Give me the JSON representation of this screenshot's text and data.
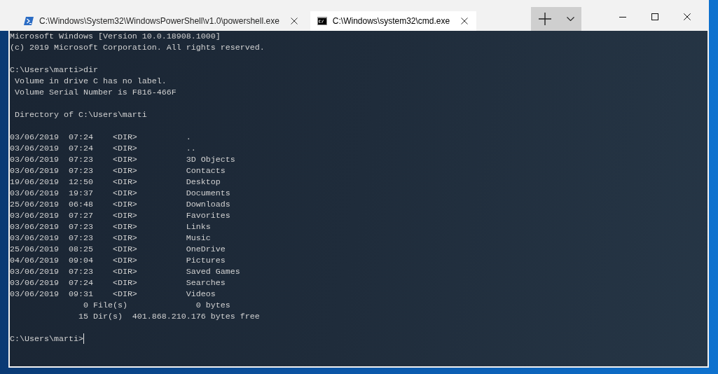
{
  "window": {
    "tabs": [
      {
        "kind": "powershell",
        "title": "C:\\Windows\\System32\\WindowsPowerShell\\v1.0\\powershell.exe",
        "selected": false
      },
      {
        "kind": "cmd",
        "title": "C:\\Windows\\system32\\cmd.exe",
        "selected": true
      }
    ]
  },
  "terminal": {
    "output_blocks": [
      [
        "Microsoft Windows [Version 10.0.18908.1000]",
        "(c) 2019 Microsoft Corporation. All rights reserved."
      ],
      [
        "C:\\Users\\marti>dir",
        " Volume in drive C has no label.",
        " Volume Serial Number is F816-466F"
      ],
      [
        " Directory of C:\\Users\\marti"
      ],
      [
        "03/06/2019  07:24    <DIR>          .",
        "03/06/2019  07:24    <DIR>          ..",
        "03/06/2019  07:23    <DIR>          3D Objects",
        "03/06/2019  07:23    <DIR>          Contacts",
        "19/06/2019  12:50    <DIR>          Desktop",
        "03/06/2019  19:37    <DIR>          Documents",
        "25/06/2019  06:48    <DIR>          Downloads",
        "03/06/2019  07:27    <DIR>          Favorites",
        "03/06/2019  07:23    <DIR>          Links",
        "03/06/2019  07:23    <DIR>          Music",
        "25/06/2019  08:25    <DIR>          OneDrive",
        "04/06/2019  09:04    <DIR>          Pictures",
        "03/06/2019  07:23    <DIR>          Saved Games",
        "03/06/2019  07:24    <DIR>          Searches",
        "03/06/2019  09:31    <DIR>          Videos",
        "               0 File(s)              0 bytes",
        "              15 Dir(s)  401.868.210.176 bytes free"
      ]
    ],
    "prompt": "C:\\Users\\marti>"
  }
}
